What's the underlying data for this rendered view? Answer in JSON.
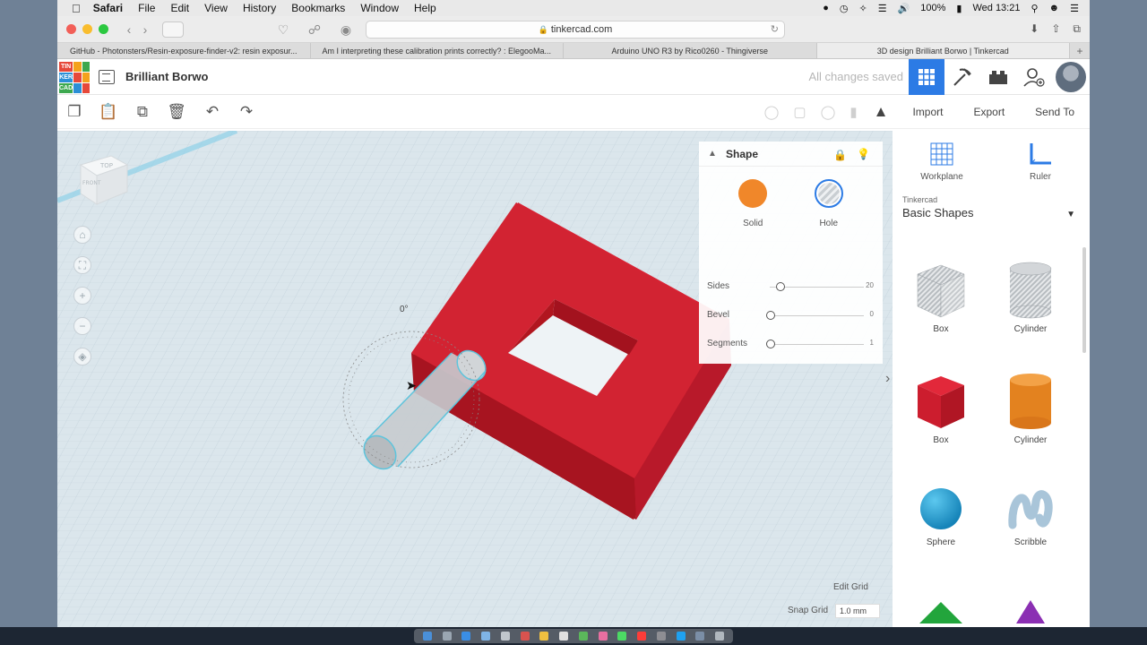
{
  "menubar": {
    "items": [
      "Safari",
      "File",
      "Edit",
      "View",
      "History",
      "Bookmarks",
      "Window",
      "Help"
    ],
    "battery": "100%",
    "clock": "Wed 13:21"
  },
  "browser": {
    "url": "tinkercad.com",
    "tabs": [
      {
        "title": "GitHub - Photonsters/Resin-exposure-finder-v2: resin exposur..."
      },
      {
        "title": "Am I interpreting these calibration prints correctly? : ElegooMa..."
      },
      {
        "title": "Arduino UNO R3 by Rico0260 - Thingiverse"
      },
      {
        "title": "3D design Brilliant Borwo | Tinkercad"
      }
    ]
  },
  "app": {
    "logo": [
      "TIN",
      "KER",
      "CAD"
    ],
    "design_name": "Brilliant Borwo",
    "save_status": "All changes saved"
  },
  "toolbar": {
    "import_label": "Import",
    "export_label": "Export",
    "sendto_label": "Send To"
  },
  "inspector": {
    "title": "Shape",
    "solid_label": "Solid",
    "hole_label": "Hole",
    "solid_color": "#f0872a",
    "sliders": [
      {
        "label": "Sides",
        "value": "20"
      },
      {
        "label": "Bevel",
        "value": "0"
      },
      {
        "label": "Segments",
        "value": "1"
      }
    ]
  },
  "viewport": {
    "rotation_readout": "0°",
    "viewcube_top": "TOP",
    "viewcube_front": "FRONT",
    "edit_grid_label": "Edit Grid",
    "snap_grid_label": "Snap Grid",
    "snap_grid_value": "1.0 mm"
  },
  "shapes_panel": {
    "workplane_label": "Workplane",
    "ruler_label": "Ruler",
    "library_small": "Tinkercad",
    "library_name": "Basic Shapes",
    "shapes": [
      {
        "label": "Box",
        "kind": "hole-box"
      },
      {
        "label": "Cylinder",
        "kind": "hole-cylinder"
      },
      {
        "label": "Box",
        "kind": "box"
      },
      {
        "label": "Cylinder",
        "kind": "cylinder"
      },
      {
        "label": "Sphere",
        "kind": "sphere"
      },
      {
        "label": "Scribble",
        "kind": "scribble"
      }
    ]
  },
  "colors": {
    "accent": "#2c7be5",
    "red_shape": "#cf1f2e",
    "hole_gray": "#b9bec3",
    "grid_bg": "#dde8ee"
  }
}
